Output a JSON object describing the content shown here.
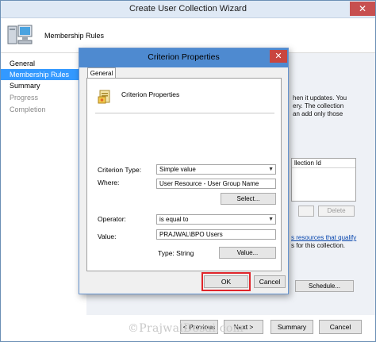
{
  "wizard": {
    "title": "Create User Collection Wizard",
    "close_glyph": "✕",
    "header_icon": "computer-icon",
    "header_text": "Membership Rules",
    "nav": [
      {
        "label": "General"
      },
      {
        "label": "Membership Rules"
      },
      {
        "label": "Summary"
      },
      {
        "label": "Progress"
      },
      {
        "label": "Completion"
      }
    ],
    "content_fragments": {
      "line1": "hen it updates. You",
      "line2": "ery. The collection",
      "line3": "an add only those",
      "collection_id_header": "llection Id",
      "delete_label": "Delete",
      "qualify_line1": "s resources that qualify",
      "qualify_line2": "s for this collection.",
      "schedule_label": "Schedule..."
    },
    "buttons": {
      "previous": "< Previous",
      "next": "Next >",
      "summary": "Summary",
      "cancel": "Cancel"
    },
    "watermark": "©PrajwalDesai.com"
  },
  "dialog": {
    "title": "Criterion Properties",
    "close_glyph": "✕",
    "tab": "General",
    "icon": "criterion-properties-icon",
    "heading": "Criterion Properties",
    "criterion_type_label": "Criterion Type:",
    "criterion_type_value": "Simple value",
    "where_label": "Where:",
    "where_value": "User Resource - User Group Name",
    "select_button": "Select...",
    "operator_label": "Operator:",
    "operator_value": "is equal to",
    "value_label": "Value:",
    "value_value": "PRAJWAL\\BPO Users",
    "type_text": "Type: String",
    "value_button": "Value...",
    "ok_button": "OK",
    "cancel_button": "Cancel"
  },
  "colors": {
    "accent_selected": "#3399ff",
    "dialog_titlebar": "#4e8ad0",
    "ok_highlight": "#e0252b"
  }
}
